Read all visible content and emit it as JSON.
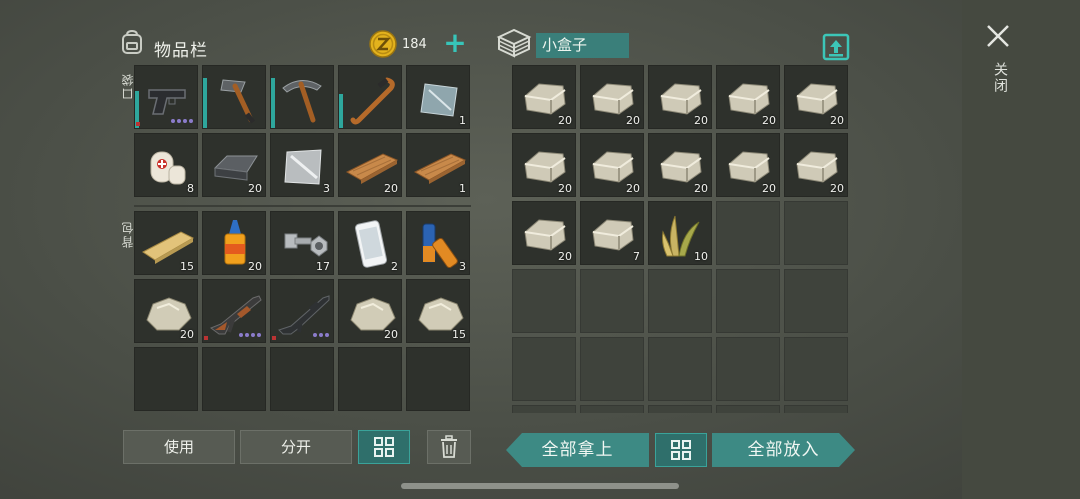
{
  "header": {
    "inventory_title": "物品栏",
    "coin_count": "184",
    "plus_label": "+",
    "container_name": "小盒子",
    "close_label": "关闭"
  },
  "sections": {
    "pocket_label": "口袋",
    "backpack_label": "背包"
  },
  "pocket": [
    {
      "icon": "pistol-icon",
      "count": "",
      "durability": 0.6,
      "dots": 4
    },
    {
      "icon": "hatchet-icon",
      "count": "",
      "durability": 0.8
    },
    {
      "icon": "pickaxe-icon",
      "count": "",
      "durability": 0.8
    },
    {
      "icon": "crowbar-icon",
      "count": "",
      "durability": 0.55
    },
    {
      "icon": "sheet-metal-icon",
      "count": "1"
    },
    {
      "icon": "first-aid-icon",
      "count": "8"
    },
    {
      "icon": "iron-ingot-icon",
      "count": "20"
    },
    {
      "icon": "aluminum-sheet-icon",
      "count": "3"
    },
    {
      "icon": "plank-icon",
      "count": "20"
    },
    {
      "icon": "plank-icon",
      "count": "1"
    }
  ],
  "backpack": [
    {
      "icon": "yellow-plank-icon",
      "count": "15"
    },
    {
      "icon": "glue-icon",
      "count": "20"
    },
    {
      "icon": "bolt-nut-icon",
      "count": "17"
    },
    {
      "icon": "phone-icon",
      "count": "2"
    },
    {
      "icon": "battery-icon",
      "count": "3"
    },
    {
      "icon": "stone-icon",
      "count": "20"
    },
    {
      "icon": "ak-rifle-icon",
      "count": "",
      "dots": 4
    },
    {
      "icon": "m4-rifle-icon",
      "count": "",
      "dots": 3
    },
    {
      "icon": "stone-icon",
      "count": "20"
    },
    {
      "icon": "stone-icon",
      "count": "15"
    },
    {
      "icon": "",
      "count": ""
    },
    {
      "icon": "",
      "count": ""
    },
    {
      "icon": "",
      "count": ""
    },
    {
      "icon": "",
      "count": ""
    },
    {
      "icon": "",
      "count": ""
    }
  ],
  "box": [
    {
      "icon": "limestone-icon",
      "count": "20"
    },
    {
      "icon": "limestone-icon",
      "count": "20"
    },
    {
      "icon": "limestone-icon",
      "count": "20"
    },
    {
      "icon": "limestone-icon",
      "count": "20"
    },
    {
      "icon": "limestone-icon",
      "count": "20"
    },
    {
      "icon": "limestone-icon",
      "count": "20"
    },
    {
      "icon": "limestone-icon",
      "count": "20"
    },
    {
      "icon": "limestone-icon",
      "count": "20"
    },
    {
      "icon": "limestone-icon",
      "count": "20"
    },
    {
      "icon": "limestone-icon",
      "count": "20"
    },
    {
      "icon": "limestone-icon",
      "count": "20"
    },
    {
      "icon": "limestone-icon",
      "count": "7"
    },
    {
      "icon": "plant-fiber-icon",
      "count": "10"
    },
    {
      "icon": "",
      "count": ""
    },
    {
      "icon": "",
      "count": ""
    }
  ],
  "buttons": {
    "use": "使用",
    "split": "分开",
    "take_all": "全部拿上",
    "put_all": "全部放入"
  },
  "colors": {
    "accent_teal": "#3d8a84",
    "plus_teal": "#37c5b9",
    "coin_gold": "#e3b21d"
  }
}
